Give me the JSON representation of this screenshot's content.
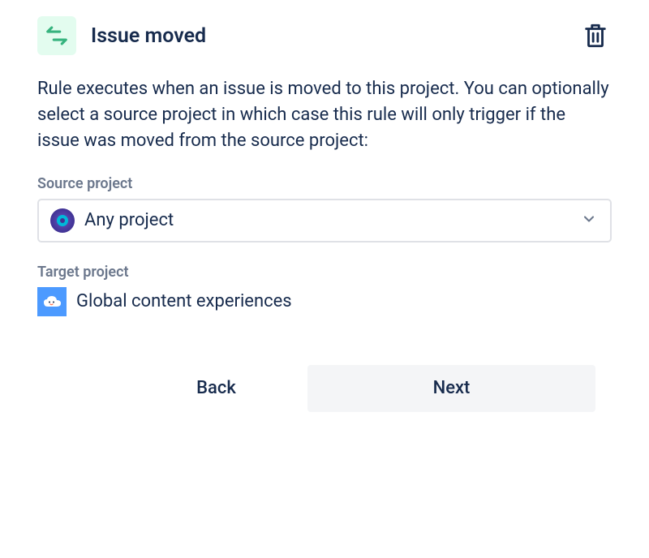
{
  "header": {
    "title": "Issue moved"
  },
  "description": "Rule executes when an issue is moved to this project. You can optionally select a source project in which case this rule will only trigger if the issue was moved from the source project:",
  "source": {
    "label": "Source project",
    "selected": "Any project"
  },
  "target": {
    "label": "Target project",
    "value": "Global content experiences"
  },
  "actions": {
    "back": "Back",
    "next": "Next"
  }
}
